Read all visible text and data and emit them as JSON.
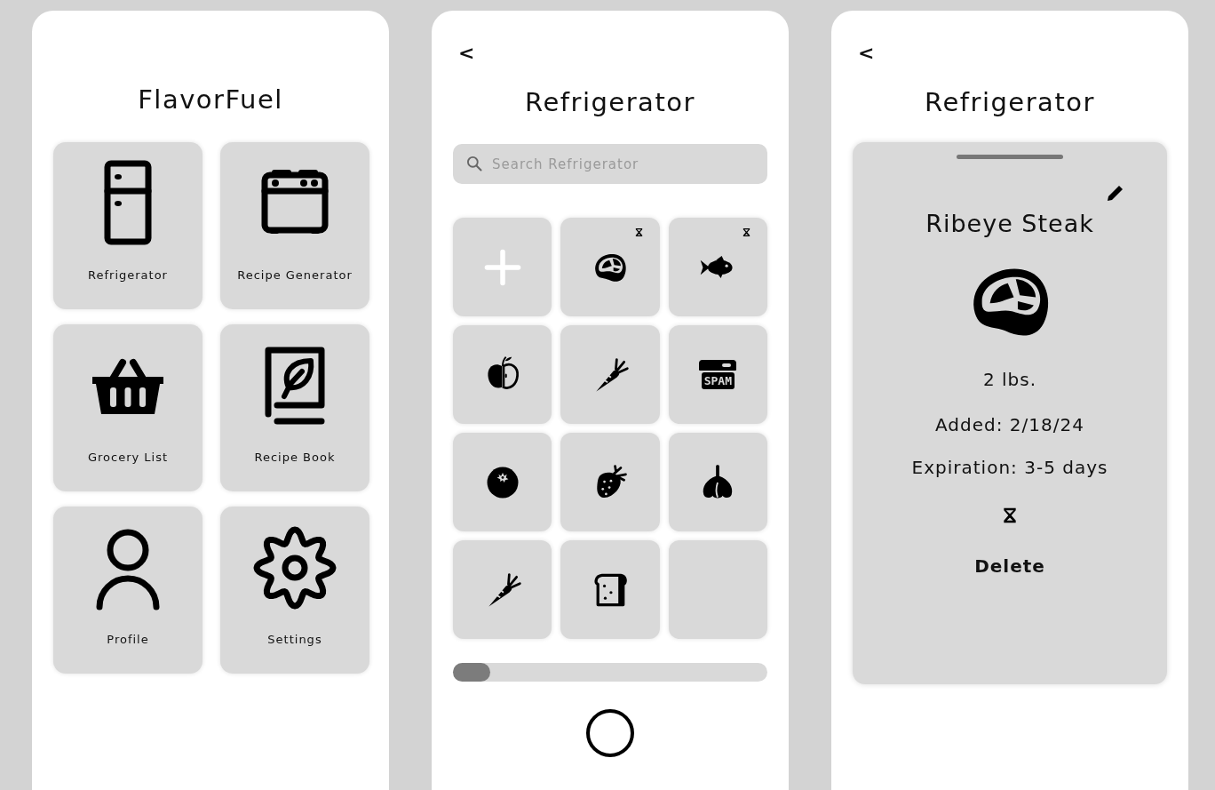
{
  "home": {
    "title": "FlavorFuel",
    "tiles": [
      {
        "label": "Refrigerator",
        "kind": "fridge"
      },
      {
        "label": "Recipe Generator",
        "kind": "stove"
      },
      {
        "label": "Grocery List",
        "kind": "basket"
      },
      {
        "label": "Recipe Book",
        "kind": "book"
      },
      {
        "label": "Profile",
        "kind": "person"
      },
      {
        "label": "Settings",
        "kind": "gear"
      }
    ]
  },
  "refrigerator": {
    "back": "<",
    "title": "Refrigerator",
    "search": {
      "placeholder": "Search Refrigerator"
    },
    "items": [
      {
        "kind": "add",
        "expiring": false
      },
      {
        "kind": "steak",
        "expiring": true
      },
      {
        "kind": "fish",
        "expiring": true
      },
      {
        "kind": "apple",
        "expiring": false
      },
      {
        "kind": "carrot",
        "expiring": false
      },
      {
        "kind": "can",
        "label": "SPAM",
        "expiring": false
      },
      {
        "kind": "blueberry",
        "expiring": false
      },
      {
        "kind": "strawberry",
        "expiring": false
      },
      {
        "kind": "garlic",
        "expiring": false
      },
      {
        "kind": "carrot",
        "expiring": false
      },
      {
        "kind": "bread",
        "expiring": false
      },
      {
        "kind": "empty",
        "expiring": false
      }
    ]
  },
  "detail": {
    "back": "<",
    "title": "Refrigerator",
    "item": {
      "name": "Ribeye Steak",
      "kind": "steak",
      "amount": "2 lbs.",
      "added": "Added: 2/18/24",
      "expiration": "Expiration: 3-5 days",
      "expiring": true,
      "action": "Delete"
    }
  }
}
